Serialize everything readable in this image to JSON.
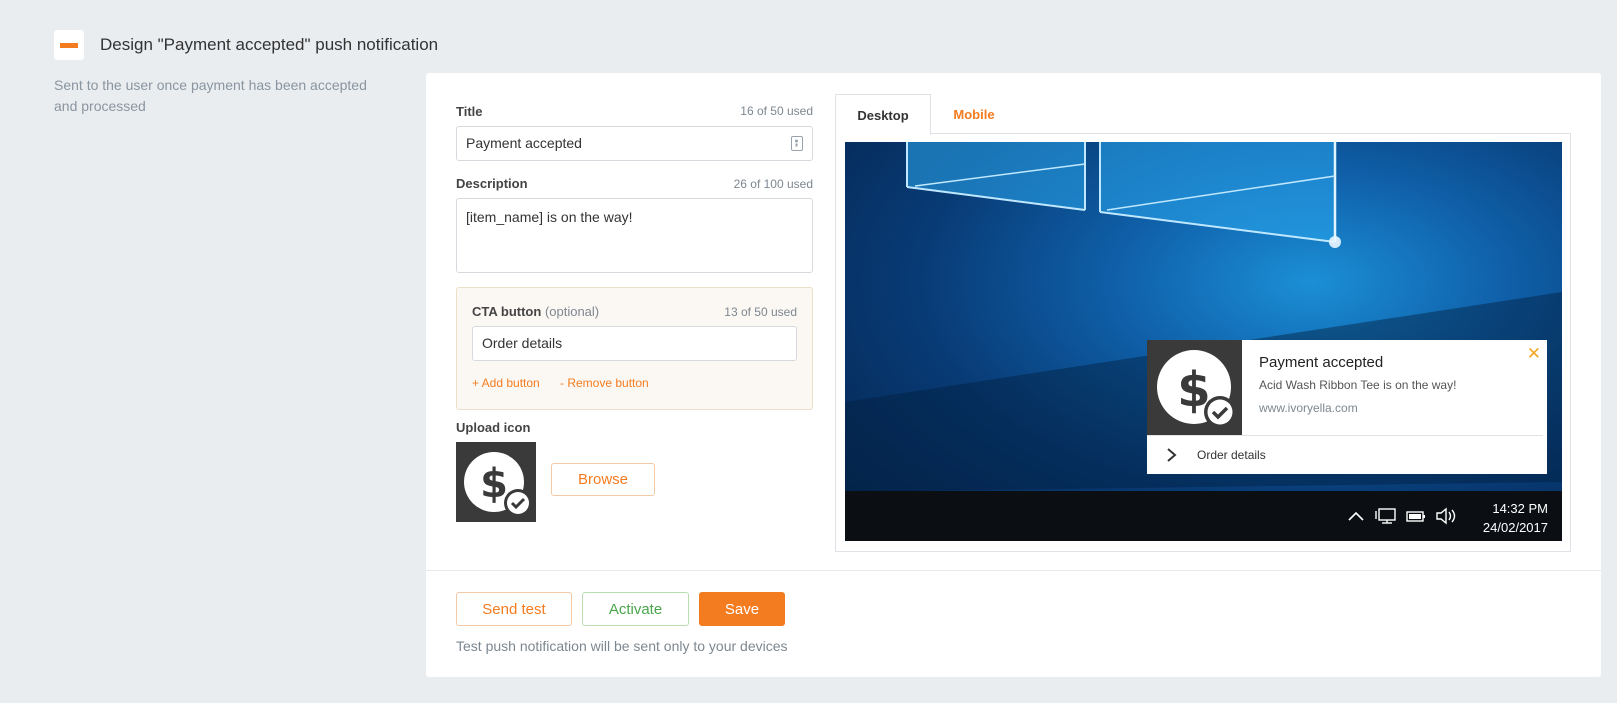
{
  "header": {
    "title": "Design \"Payment accepted\" push notification",
    "description": "Sent to the user once payment has been accepted and processed"
  },
  "form": {
    "title": {
      "label": "Title",
      "count": "16 of 50 used",
      "value": "Payment accepted"
    },
    "description": {
      "label": "Description",
      "count": "26 of 100 used",
      "value": "[item_name] is on the way!"
    },
    "cta": {
      "label": "CTA button",
      "optional": "(optional)",
      "count": "13 of 50 used",
      "value": "Order details",
      "add_label": "+ Add button",
      "remove_label": "- Remove button"
    },
    "upload": {
      "label": "Upload icon",
      "browse_label": "Browse"
    }
  },
  "preview": {
    "tabs": [
      {
        "label": "Desktop",
        "active": true
      },
      {
        "label": "Mobile",
        "active": false
      }
    ],
    "notification": {
      "title": "Payment accepted",
      "body": "Acid Wash Ribbon Tee is on the way!",
      "url": "www.ivoryella.com",
      "action_label": "Order details",
      "close_glyph": "✕"
    },
    "taskbar": {
      "time": "14:32 PM",
      "date": "24/02/2017"
    }
  },
  "actions": {
    "send_test_label": "Send test",
    "activate_label": "Activate",
    "save_label": "Save",
    "note": "Test push notification will be sent only to your devices"
  },
  "colors": {
    "accent": "#f47c20",
    "success": "#4ba64b",
    "background": "#e9edf0"
  }
}
